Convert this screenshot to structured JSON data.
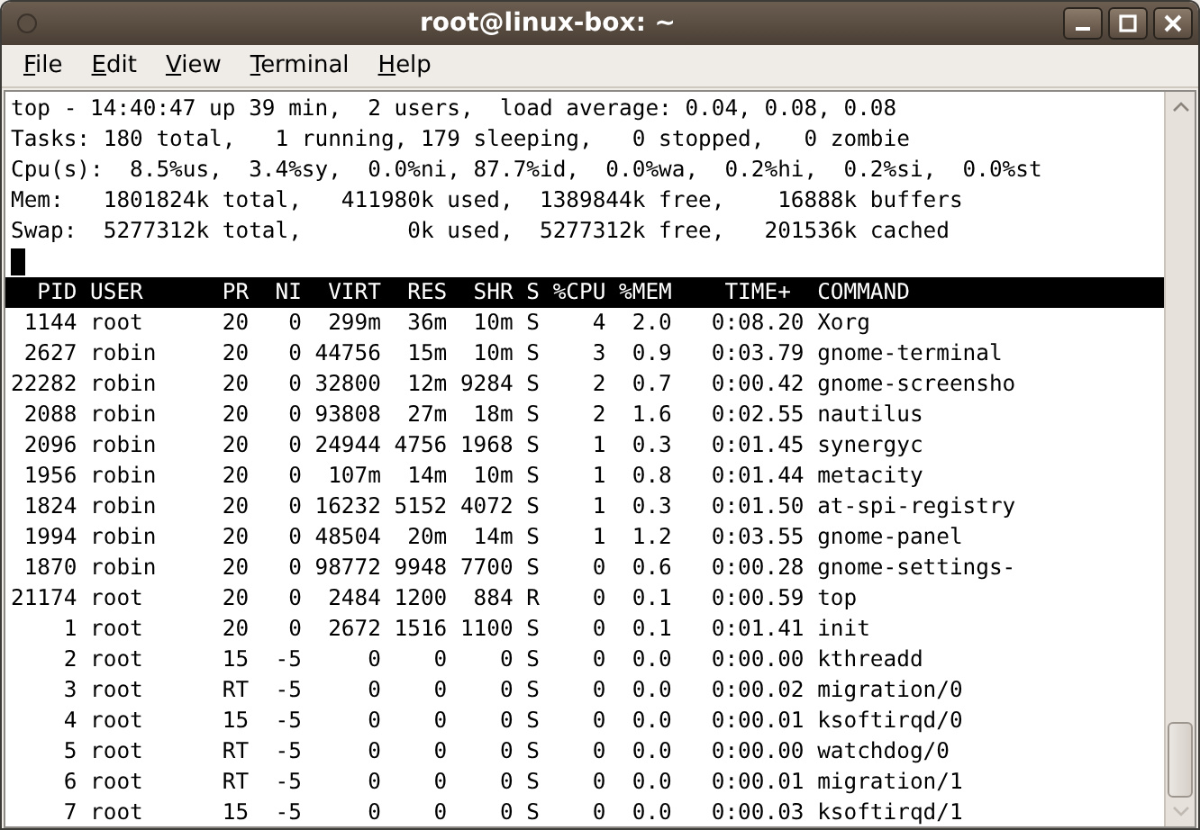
{
  "window": {
    "title": "root@linux-box: ~"
  },
  "menu": [
    {
      "label": "File"
    },
    {
      "label": "Edit"
    },
    {
      "label": "View"
    },
    {
      "label": "Terminal"
    },
    {
      "label": "Help"
    }
  ],
  "terminal": {
    "summary_lines": [
      "top - 14:40:47 up 39 min,  2 users,  load average: 0.04, 0.08, 0.08",
      "Tasks: 180 total,   1 running, 179 sleeping,   0 stopped,   0 zombie",
      "Cpu(s):  8.5%us,  3.4%sy,  0.0%ni, 87.7%id,  0.0%wa,  0.2%hi,  0.2%si,  0.0%st",
      "Mem:   1801824k total,   411980k used,  1389844k free,    16888k buffers",
      "Swap:  5277312k total,        0k used,  5277312k free,   201536k cached"
    ],
    "process_table": {
      "header": "  PID USER      PR  NI  VIRT  RES  SHR S %CPU %MEM    TIME+  COMMAND",
      "rows": [
        " 1144 root      20   0  299m  36m  10m S    4  2.0   0:08.20 Xorg",
        " 2627 robin     20   0 44756  15m  10m S    3  0.9   0:03.79 gnome-terminal",
        "22282 robin     20   0 32800  12m 9284 S    2  0.7   0:00.42 gnome-screensho",
        " 2088 robin     20   0 93808  27m  18m S    2  1.6   0:02.55 nautilus",
        " 2096 robin     20   0 24944 4756 1968 S    1  0.3   0:01.45 synergyc",
        " 1956 robin     20   0  107m  14m  10m S    1  0.8   0:01.44 metacity",
        " 1824 robin     20   0 16232 5152 4072 S    1  0.3   0:01.50 at-spi-registry",
        " 1994 robin     20   0 48504  20m  14m S    1  1.2   0:03.55 gnome-panel",
        " 1870 robin     20   0 98772 9948 7700 S    0  0.6   0:00.28 gnome-settings-",
        "21174 root      20   0  2484 1200  884 R    0  0.1   0:00.59 top",
        "    1 root      20   0  2672 1516 1100 S    0  0.1   0:01.41 init",
        "    2 root      15  -5     0    0    0 S    0  0.0   0:00.00 kthreadd",
        "    3 root      RT  -5     0    0    0 S    0  0.0   0:00.02 migration/0",
        "    4 root      15  -5     0    0    0 S    0  0.0   0:00.01 ksoftirqd/0",
        "    5 root      RT  -5     0    0    0 S    0  0.0   0:00.00 watchdog/0",
        "    6 root      RT  -5     0    0    0 S    0  0.0   0:00.01 migration/1",
        "    7 root      15  -5     0    0    0 S    0  0.0   0:00.03 ksoftirqd/1"
      ]
    }
  }
}
